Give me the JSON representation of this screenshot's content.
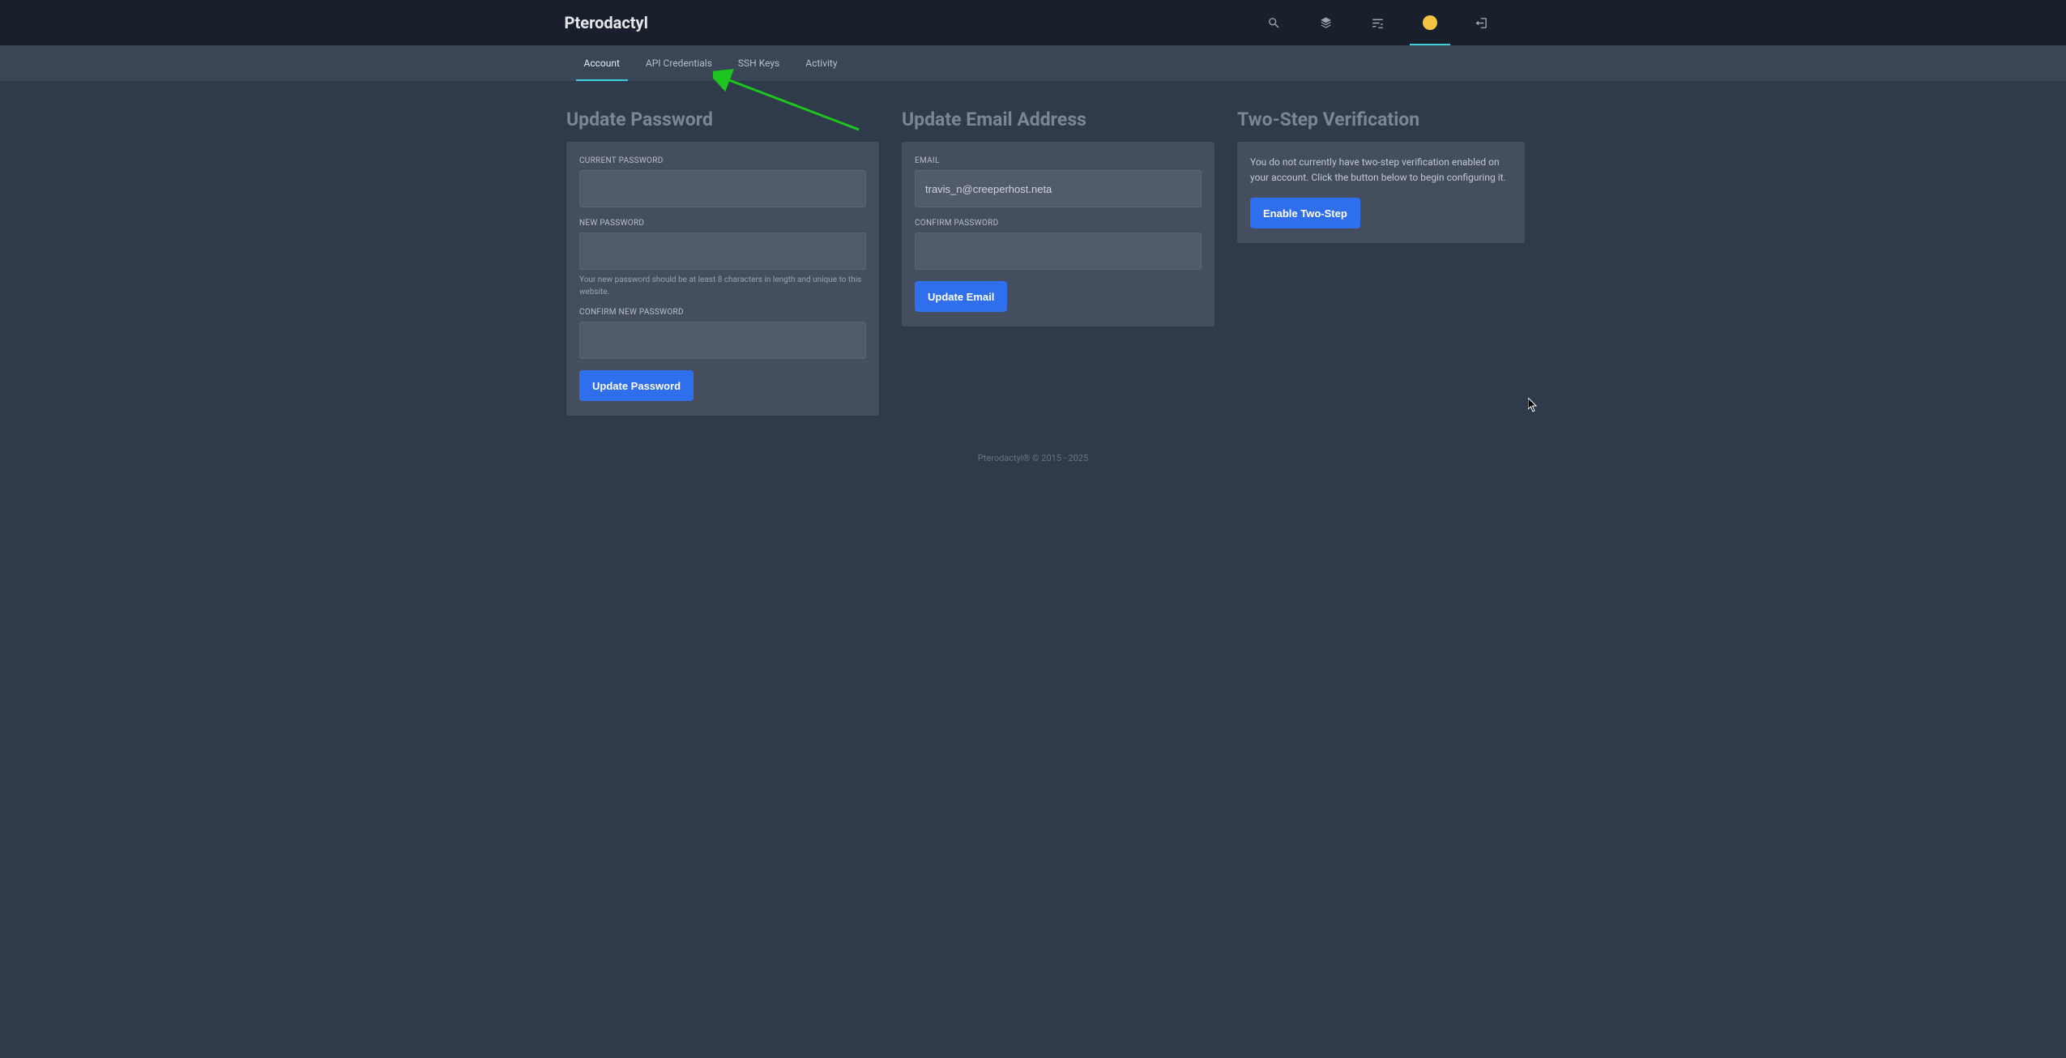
{
  "brand": "Pterodactyl",
  "tabs": {
    "account": "Account",
    "api": "API Credentials",
    "ssh": "SSH Keys",
    "activity": "Activity"
  },
  "password": {
    "title": "Update Password",
    "current_label": "CURRENT PASSWORD",
    "new_label": "NEW PASSWORD",
    "hint": "Your new password should be at least 8 characters in length and unique to this website.",
    "confirm_label": "CONFIRM NEW PASSWORD",
    "button": "Update Password"
  },
  "email": {
    "title": "Update Email Address",
    "label": "EMAIL",
    "value": "travis_n@creeperhost.neta",
    "confirm_label": "CONFIRM PASSWORD",
    "button": "Update Email"
  },
  "twostep": {
    "title": "Two-Step Verification",
    "body": "You do not currently have two-step verification enabled on your account. Click the button below to begin configuring it.",
    "button": "Enable Two-Step"
  },
  "footer": "Pterodactyl® © 2015 - 2025"
}
